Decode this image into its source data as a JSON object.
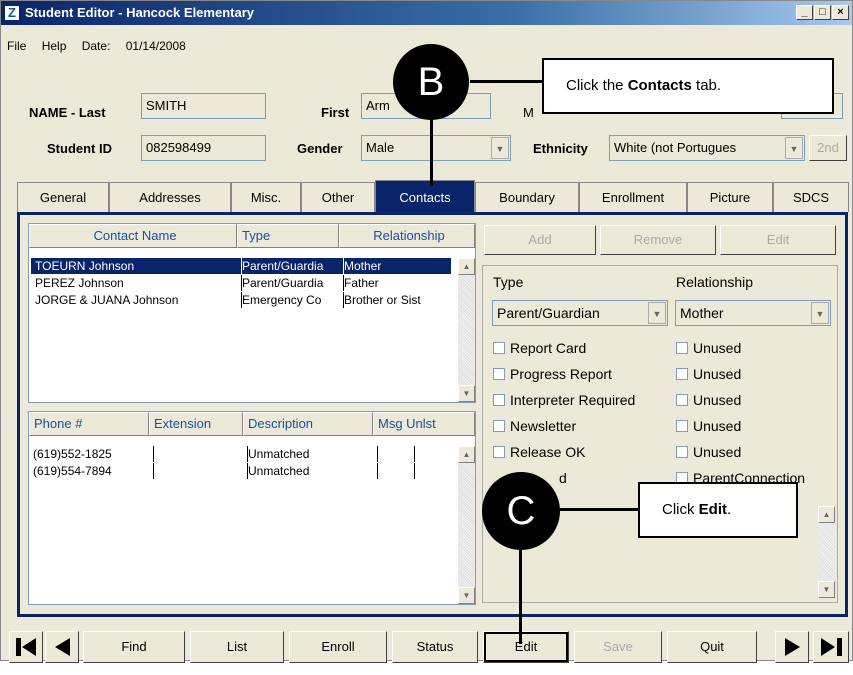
{
  "window": {
    "title": "Student Editor - Hancock Elementary",
    "min": "_",
    "max": "□",
    "close": "×"
  },
  "menu": {
    "file": "File",
    "help": "Help",
    "date_label": "Date:",
    "date_value": "01/14/2008"
  },
  "fields": {
    "last_label": "NAME - Last",
    "last_value": "SMITH",
    "first_label": "First",
    "first_value": "Arm",
    "middle_label": "M",
    "id_label": "Student ID",
    "id_value": "082598499",
    "gender_label": "Gender",
    "gender_value": "Male",
    "ethnicity_label": "Ethnicity",
    "ethnicity_value": "White (not Portugues",
    "second_button": "2nd"
  },
  "tabs": [
    "General",
    "Addresses",
    "Misc.",
    "Other",
    "Contacts",
    "Boundary",
    "Enrollment",
    "Picture",
    "SDCS"
  ],
  "active_tab": "Contacts",
  "contacts": {
    "headers": [
      "Contact Name",
      "Type",
      "Relationship"
    ],
    "rows": [
      [
        "TOEURN Johnson",
        "Parent/Guardia",
        "Mother"
      ],
      [
        "PEREZ Johnson",
        "Parent/Guardia",
        "Father"
      ],
      [
        "JORGE & JUANA Johnson",
        "Emergency Co",
        "Brother or Sist"
      ]
    ]
  },
  "phones": {
    "headers": [
      "Phone #",
      "Extension",
      "Description",
      "Msg Unlst"
    ],
    "rows": [
      [
        "(619)552-1825",
        "",
        "Unmatched"
      ],
      [
        "(619)554-7894",
        "",
        "Unmatched"
      ]
    ]
  },
  "detail": {
    "add": "Add",
    "remove": "Remove",
    "edit": "Edit",
    "type_label": "Type",
    "relationship_label": "Relationship",
    "type_value": "Parent/Guardian",
    "relationship_value": "Mother",
    "checks_left": [
      "Report Card",
      "Progress Report",
      "Interpreter Required",
      "Newsletter",
      "Release OK",
      "d"
    ],
    "checks_right": [
      "Unused",
      "Unused",
      "Unused",
      "Unused",
      "Unused",
      "ParentConnection"
    ]
  },
  "bottom": {
    "find": "Find",
    "list": "List",
    "enroll": "Enroll",
    "status": "Status",
    "edit": "Edit",
    "save": "Save",
    "quit": "Quit"
  },
  "callouts": {
    "b_letter": "B",
    "b_text_pre": "Click the ",
    "b_text_bold": "Contacts",
    "b_text_post": " tab.",
    "c_letter": "C",
    "c_text_pre": "Click ",
    "c_text_bold": "Edit",
    "c_text_post": "."
  }
}
